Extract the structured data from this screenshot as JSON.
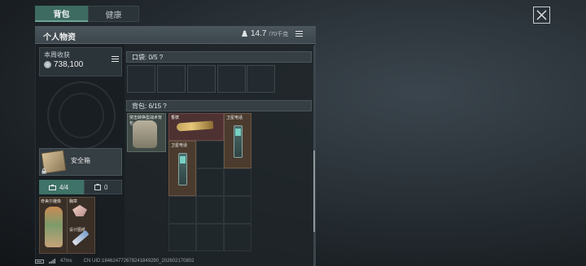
{
  "tabs": [
    {
      "label": "背包",
      "active": true
    },
    {
      "label": "健康",
      "active": false
    }
  ],
  "panel": {
    "title": "个人物资",
    "weight": "14.7",
    "weight_max": "/70千克"
  },
  "weekly": {
    "label": "本周收获",
    "value": "738,100"
  },
  "pocket": {
    "label": "口袋: 0/5 ?",
    "slots": 5
  },
  "backpack": {
    "label": "背包: 6/15 ?",
    "items": [
      {
        "name": "突击转换型战术背包",
        "type": "backpack"
      },
      {
        "name": "香槟",
        "type": "bottle"
      },
      {
        "name": "卫星电话",
        "type": "satellite-phone"
      },
      {
        "name": "卫星电话",
        "type": "satellite-phone"
      }
    ]
  },
  "safe_box": {
    "label": "安全箱"
  },
  "mini_tabs": [
    {
      "label": "4/4",
      "icon": "briefcase-icon"
    },
    {
      "label": "0",
      "icon": "case-icon"
    }
  ],
  "charms": [
    {
      "name": "奇美尔雕像"
    },
    {
      "name": "胸章"
    },
    {
      "name": "设计图纸"
    }
  ],
  "footer": {
    "ping": "47ms",
    "uid": "CN UID:18462477267824184929​0_202602170802"
  },
  "colors": {
    "accent": "#3d6b62",
    "panel": "#1e2428",
    "red_slot": "#4e3232",
    "brown_slot": "#4b3b2e"
  }
}
